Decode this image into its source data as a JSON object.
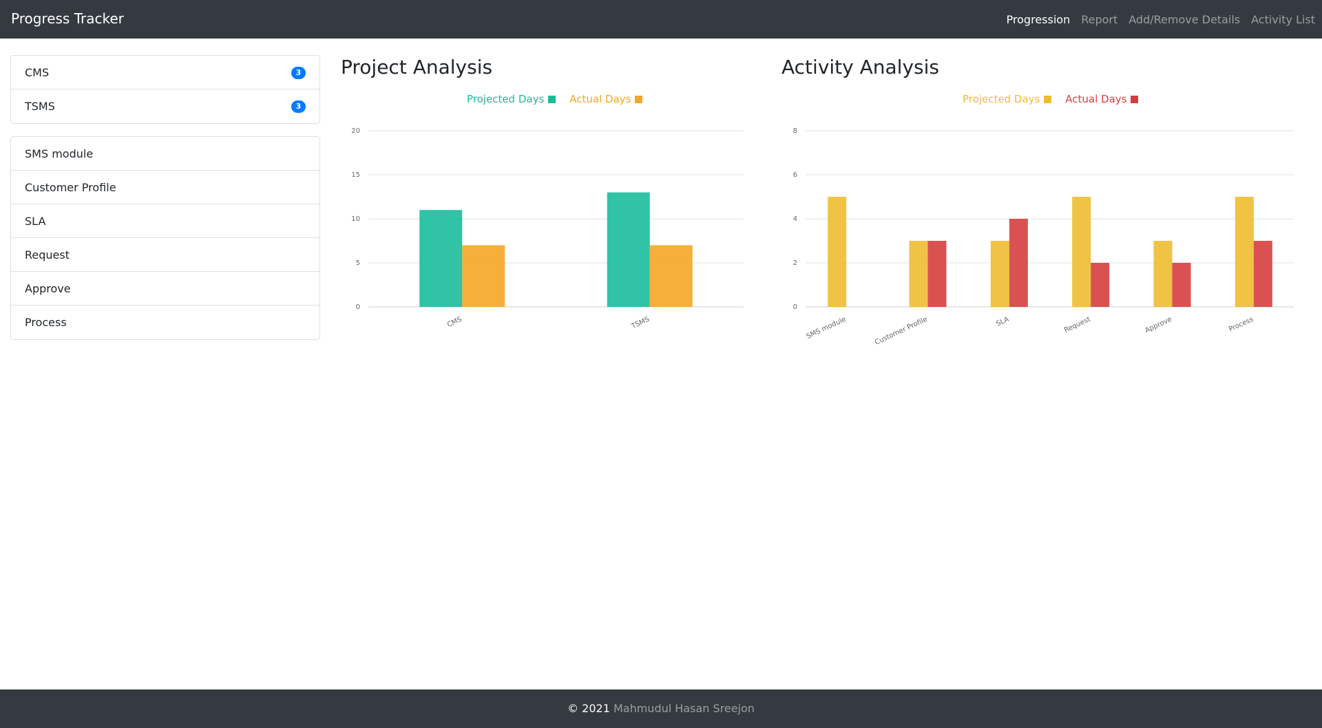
{
  "navbar": {
    "brand": "Progress Tracker",
    "links": [
      "Progression",
      "Report",
      "Add/Remove Details",
      "Activity List"
    ],
    "active_link": "Progression"
  },
  "sidebar": {
    "projects": [
      {
        "label": "CMS",
        "badge": "3"
      },
      {
        "label": "TSMS",
        "badge": "3"
      }
    ],
    "activities": [
      "SMS module",
      "Customer Profile",
      "SLA",
      "Request",
      "Approve",
      "Process"
    ]
  },
  "colors": {
    "navbar_bg": "#343a40",
    "badge": "#007bff",
    "project_projected": "#1abc9c",
    "project_actual": "#f5a623",
    "activity_projected": "#eebc30",
    "activity_actual": "#d63e3e"
  },
  "chart_data": [
    {
      "type": "bar",
      "title": "Project Analysis",
      "categories": [
        "CMS",
        "TSMS"
      ],
      "series": [
        {
          "name": "Projected Days",
          "values": [
            11,
            13
          ]
        },
        {
          "name": "Actual Days",
          "values": [
            7,
            7
          ]
        }
      ],
      "ylim": [
        0,
        20
      ],
      "yticks": [
        0,
        5,
        10,
        15,
        20
      ],
      "grid": true,
      "legend_position": "top-center"
    },
    {
      "type": "bar",
      "title": "Activity Analysis",
      "categories": [
        "SMS module",
        "Customer Profile",
        "SLA",
        "Request",
        "Approve",
        "Process"
      ],
      "series": [
        {
          "name": "Projected Days",
          "values": [
            5,
            3,
            3,
            5,
            3,
            5
          ]
        },
        {
          "name": "Actual Days",
          "values": [
            0,
            3,
            4,
            2,
            2,
            3
          ]
        }
      ],
      "ylim": [
        0,
        8
      ],
      "yticks": [
        0,
        2,
        4,
        6,
        8
      ],
      "grid": true,
      "legend_position": "top-center"
    }
  ],
  "footer": {
    "copyright": "© 2021",
    "author": "Mahmudul Hasan Sreejon"
  }
}
